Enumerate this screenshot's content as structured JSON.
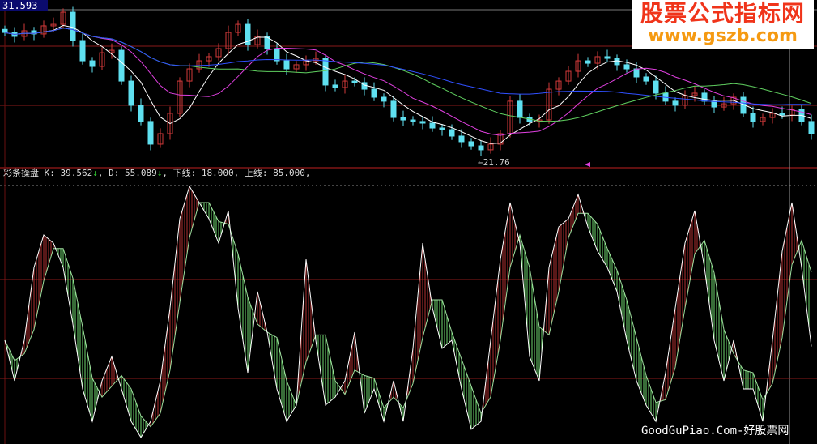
{
  "price_label": "31.593",
  "low_label": "←21.76",
  "logo": {
    "title": "股票公式指标网",
    "url": "www.gszb.com"
  },
  "watermark": "GoodGuPiao.Com-好股票网",
  "indicator": {
    "name": "彩条操盘",
    "k_label": "K:",
    "k_value": "39.562",
    "k_arrow": "↓",
    "d_label": "D:",
    "d_value": "55.089",
    "d_arrow": "↓",
    "lower_label": "下线:",
    "lower_value": "18.000",
    "upper_label": "上线:",
    "upper_value": "85.000"
  },
  "colors": {
    "up": "#d23a3a",
    "down": "#5fe0f0",
    "k_above": "#b03030",
    "k_below": "#6fd86f",
    "grid": "#8a1a1a"
  },
  "chart_data": [
    {
      "type": "candlestick",
      "price_high": 31.593,
      "price_low": 21.76,
      "closes": [
        29.73,
        29.47,
        29.84,
        29.63,
        30.16,
        30.26,
        31.06,
        29.2,
        27.87,
        27.5,
        28.4,
        28.56,
        26.54,
        24.95,
        23.89,
        22.4,
        23.09,
        24.42,
        26.54,
        27.34,
        27.87,
        28.14,
        28.67,
        29.73,
        30.26,
        28.93,
        29.47,
        28.67,
        27.87,
        27.34,
        27.61,
        27.87,
        28.03,
        26.28,
        26.12,
        26.54,
        26.44,
        26.01,
        25.48,
        25.22,
        24.15,
        23.99,
        23.89,
        23.78,
        23.46,
        23.35,
        22.93,
        22.56,
        22.29,
        22.03,
        22.4,
        23.09,
        25.22,
        24.15,
        23.89,
        23.99,
        26.01,
        26.54,
        27.18,
        27.87,
        27.71,
        28.14,
        28.03,
        27.61,
        27.34,
        26.81,
        26.54,
        25.75,
        25.22,
        24.95,
        25.59,
        25.75,
        25.22,
        24.84,
        25.05,
        25.48,
        24.42,
        23.89,
        24.15,
        24.42,
        24.31,
        24.68,
        23.89,
        23.09
      ],
      "moving_averages": [
        5,
        10,
        20,
        40
      ]
    },
    {
      "type": "line",
      "name": "彩条操盘",
      "k": [
        43.8,
        16.3,
        43.8,
        93.2,
        115.2,
        109.7,
        93.2,
        54.8,
        10.8,
        -11.2,
        16.3,
        32.8,
        10.8,
        -11.2,
        -22.1,
        -11.2,
        16.3,
        65.8,
        126.2,
        148.2,
        137.2,
        126.2,
        109.7,
        131.7,
        65.8,
        21.8,
        76.8,
        49.3,
        10.8,
        -11.2,
        -0.2,
        98.7,
        43.8,
        -0.2,
        5.3,
        16.3,
        49.3,
        -5.7,
        10.8,
        -11.2,
        16.3,
        -11.2,
        38.3,
        109.7,
        65.8,
        38.3,
        43.8,
        10.8,
        -16.6,
        -11.2,
        43.8,
        98.7,
        137.2,
        109.7,
        32.8,
        16.3,
        93.2,
        120.7,
        126.2,
        142.7,
        120.7,
        104.2,
        93.2,
        76.8,
        43.8,
        16.3,
        -0.2,
        -11.2,
        21.8,
        65.8,
        109.7,
        131.7,
        93.2,
        43.8,
        16.3,
        43.8,
        10.8,
        10.8,
        -11.2,
        43.8,
        104.2,
        137.2,
        93.2,
        39.6
      ],
      "reference_lines": [
        18,
        85
      ]
    }
  ]
}
